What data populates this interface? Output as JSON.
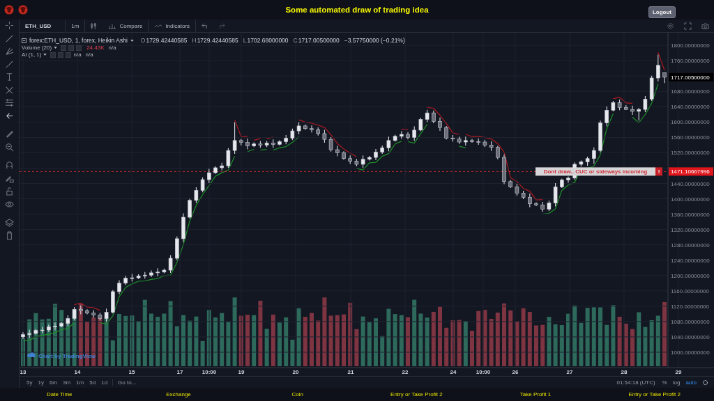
{
  "header": {
    "title": "Some automated draw of trading idea",
    "logout": "Logout"
  },
  "toolbar": {
    "symbol": "ETH_USD",
    "interval": "1m",
    "compare": "Compare",
    "indicators": "Indicators"
  },
  "legend": {
    "series": "forex:ETH_USD, 1, forex, Heikin Ashi",
    "ohlc": [
      {
        "label": "O",
        "value": "1729.42440585"
      },
      {
        "label": "H",
        "value": "1729.42440585"
      },
      {
        "label": "L",
        "value": "1702.68000000"
      },
      {
        "label": "C",
        "value": "1717.00500000"
      }
    ],
    "change": "−3.57750000 (−0.21%)",
    "studies": [
      {
        "name": "Volume (20)",
        "value": "24.43K",
        "extra": [
          "n/a"
        ]
      },
      {
        "name": "AI (1, 1)",
        "extra": [
          "n/a",
          "n/a"
        ]
      }
    ]
  },
  "chart": {
    "chart_data": {
      "type": "candlestick",
      "grid": true,
      "ylim": [
        960,
        1833
      ],
      "yticks": [
        {
          "value": 1800,
          "label": "1800.00000000"
        },
        {
          "value": 1760,
          "label": "1760.00000000"
        },
        {
          "value": 1680,
          "label": "1680.00000000"
        },
        {
          "value": 1640,
          "label": "1640.00000000"
        },
        {
          "value": 1600,
          "label": "1600.00000000"
        },
        {
          "value": 1560,
          "label": "1560.00000000"
        },
        {
          "value": 1520,
          "label": "1520.00000000"
        },
        {
          "value": 1440,
          "label": "1440.00000000"
        },
        {
          "value": 1400,
          "label": "1400.00000000"
        },
        {
          "value": 1360,
          "label": "1360.00000000"
        },
        {
          "value": 1320,
          "label": "1320.00000000"
        },
        {
          "value": 1280,
          "label": "1280.00000000"
        },
        {
          "value": 1240,
          "label": "1240.00000000"
        },
        {
          "value": 1200,
          "label": "1200.00000000"
        },
        {
          "value": 1160,
          "label": "1160.00000000"
        },
        {
          "value": 1120,
          "label": "1120.00000000"
        },
        {
          "value": 1080,
          "label": "1080.00000000"
        },
        {
          "value": 1040,
          "label": "1040.00000000"
        },
        {
          "value": 1000,
          "label": "1000.00000000"
        }
      ],
      "categories": [
        null,
        null,
        null,
        null,
        null,
        null,
        null,
        null,
        null,
        null,
        null,
        null,
        null,
        null,
        null,
        null,
        null,
        null,
        null,
        null,
        null,
        null,
        null,
        null,
        null,
        null,
        null,
        null,
        null,
        null,
        null,
        null,
        null,
        null,
        null,
        null,
        null,
        null,
        null,
        null,
        null,
        null,
        null,
        null,
        null,
        null,
        null,
        null,
        null,
        null,
        null,
        null,
        null,
        null,
        null,
        null,
        null,
        null,
        null,
        null,
        null,
        null,
        null,
        null,
        null,
        null,
        null,
        null,
        null,
        null,
        null,
        null,
        null,
        null,
        null,
        null,
        null,
        null,
        null,
        null,
        null,
        null,
        null,
        null,
        null,
        null,
        null,
        null,
        null,
        null,
        null,
        null,
        null,
        null,
        null,
        null,
        null,
        null,
        null,
        null,
        null
      ],
      "ohlc": [
        [
          1040,
          1052,
          1035,
          1046
        ],
        [
          1046,
          1059,
          1037,
          1049
        ],
        [
          1049,
          1061,
          1046,
          1057
        ],
        [
          1057,
          1066,
          1050,
          1058
        ],
        [
          1058,
          1072,
          1053,
          1066
        ],
        [
          1066,
          1078,
          1057,
          1068
        ],
        [
          1068,
          1079,
          1065,
          1075
        ],
        [
          1075,
          1096,
          1068,
          1088
        ],
        [
          1088,
          1118,
          1083,
          1112
        ],
        [
          1112,
          1122,
          1099,
          1108
        ],
        [
          1108,
          1112,
          1099,
          1102
        ],
        [
          1102,
          1110,
          1090,
          1097
        ],
        [
          1097,
          1103,
          1083,
          1088
        ],
        [
          1088,
          1114,
          1079,
          1104
        ],
        [
          1104,
          1162,
          1101,
          1158
        ],
        [
          1158,
          1188,
          1151,
          1180
        ],
        [
          1180,
          1199,
          1175,
          1193
        ],
        [
          1193,
          1204,
          1184,
          1194
        ],
        [
          1194,
          1203,
          1191,
          1199
        ],
        [
          1199,
          1209,
          1192,
          1201
        ],
        [
          1201,
          1213,
          1196,
          1207
        ],
        [
          1207,
          1219,
          1198,
          1209
        ],
        [
          1209,
          1218,
          1206,
          1214
        ],
        [
          1214,
          1253,
          1207,
          1245
        ],
        [
          1245,
          1302,
          1240,
          1296
        ],
        [
          1296,
          1362,
          1287,
          1352
        ],
        [
          1352,
          1400,
          1349,
          1396
        ],
        [
          1396,
          1430,
          1389,
          1422
        ],
        [
          1422,
          1456,
          1417,
          1450
        ],
        [
          1450,
          1478,
          1441,
          1468
        ],
        [
          1468,
          1485,
          1465,
          1481
        ],
        [
          1481,
          1494,
          1474,
          1486
        ],
        [
          1486,
          1532,
          1481,
          1526
        ],
        [
          1526,
          1600,
          1517,
          1552
        ],
        [
          1552,
          1556,
          1539,
          1547
        ],
        [
          1547,
          1557,
          1529,
          1538
        ],
        [
          1538,
          1547,
          1535,
          1543
        ],
        [
          1543,
          1551,
          1533,
          1540
        ],
        [
          1540,
          1551,
          1535,
          1545
        ],
        [
          1545,
          1555,
          1533,
          1542
        ],
        [
          1542,
          1553,
          1539,
          1549
        ],
        [
          1549,
          1566,
          1542,
          1558
        ],
        [
          1558,
          1583,
          1553,
          1577
        ],
        [
          1577,
          1600,
          1568,
          1590
        ],
        [
          1590,
          1594,
          1580,
          1583
        ],
        [
          1583,
          1591,
          1573,
          1580
        ],
        [
          1580,
          1586,
          1565,
          1570
        ],
        [
          1570,
          1580,
          1546,
          1555
        ],
        [
          1555,
          1561,
          1523,
          1528
        ],
        [
          1528,
          1538,
          1511,
          1520
        ],
        [
          1520,
          1524,
          1502,
          1505
        ],
        [
          1505,
          1513,
          1491,
          1498
        ],
        [
          1498,
          1504,
          1485,
          1490
        ],
        [
          1490,
          1513,
          1481,
          1503
        ],
        [
          1503,
          1512,
          1500,
          1508
        ],
        [
          1508,
          1530,
          1501,
          1522
        ],
        [
          1522,
          1539,
          1517,
          1533
        ],
        [
          1533,
          1562,
          1524,
          1552
        ],
        [
          1552,
          1567,
          1549,
          1563
        ],
        [
          1563,
          1576,
          1556,
          1568
        ],
        [
          1568,
          1574,
          1555,
          1560
        ],
        [
          1560,
          1589,
          1551,
          1579
        ],
        [
          1579,
          1611,
          1576,
          1607
        ],
        [
          1607,
          1632,
          1600,
          1624
        ],
        [
          1624,
          1630,
          1597,
          1602
        ],
        [
          1602,
          1612,
          1577,
          1586
        ],
        [
          1586,
          1590,
          1555,
          1558
        ],
        [
          1558,
          1566,
          1549,
          1556
        ],
        [
          1556,
          1562,
          1543,
          1548
        ],
        [
          1548,
          1562,
          1539,
          1552
        ],
        [
          1552,
          1556,
          1546,
          1549
        ],
        [
          1549,
          1557,
          1541,
          1548
        ],
        [
          1548,
          1554,
          1535,
          1540
        ],
        [
          1540,
          1550,
          1525,
          1534
        ],
        [
          1534,
          1538,
          1503,
          1508
        ],
        [
          1508,
          1516,
          1438,
          1445
        ],
        [
          1445,
          1449,
          1428,
          1431
        ],
        [
          1431,
          1439,
          1408,
          1415
        ],
        [
          1415,
          1421,
          1399,
          1404
        ],
        [
          1404,
          1414,
          1378,
          1387
        ],
        [
          1387,
          1391,
          1381,
          1384
        ],
        [
          1384,
          1392,
          1366,
          1373
        ],
        [
          1373,
          1395,
          1368,
          1389
        ],
        [
          1389,
          1441,
          1380,
          1431
        ],
        [
          1431,
          1453,
          1428,
          1449
        ],
        [
          1449,
          1458,
          1442,
          1454
        ],
        [
          1454,
          1495,
          1449,
          1490
        ],
        [
          1490,
          1500,
          1484,
          1496
        ],
        [
          1496,
          1510,
          1486,
          1505
        ],
        [
          1505,
          1534,
          1491,
          1526
        ],
        [
          1526,
          1604,
          1521,
          1598
        ],
        [
          1598,
          1641,
          1589,
          1631
        ],
        [
          1631,
          1655,
          1628,
          1651
        ],
        [
          1651,
          1659,
          1631,
          1638
        ],
        [
          1638,
          1644,
          1632,
          1633
        ],
        [
          1633,
          1643,
          1619,
          1628
        ],
        [
          1628,
          1637,
          1604,
          1633
        ],
        [
          1633,
          1668,
          1626,
          1660
        ],
        [
          1660,
          1721,
          1655,
          1715
        ],
        [
          1715,
          1776,
          1706,
          1748
        ],
        [
          1729,
          1729,
          1702,
          1717
        ]
      ]
    }
  },
  "price_axis": {
    "last_price": "1717.00500000",
    "alert_price": "1471.10667996"
  },
  "annotation": {
    "text": "Dont draw.. CUC or sideways incoming",
    "badge": "!"
  },
  "time_axis": [
    "13",
    "14",
    "15",
    "17",
    "10:00",
    "19",
    "20",
    "21",
    "22",
    "24",
    "10:00",
    "26",
    "27",
    "28",
    "29"
  ],
  "attribution": "Chart by TradingView",
  "range_bar": {
    "ranges": [
      "5y",
      "1y",
      "6m",
      "3m",
      "1m",
      "5d",
      "1d"
    ],
    "goto": "Go to...",
    "clock": "01:54:18 (UTC)",
    "scale": [
      {
        "label": "%",
        "selected": false
      },
      {
        "label": "log",
        "selected": false
      },
      {
        "label": "auto",
        "selected": true
      }
    ]
  },
  "footer": [
    "Date Time",
    "Exchange",
    "Coin",
    "Entry or Take Profit 2",
    "Take Profit 1",
    "Entry or Take Profit 2"
  ]
}
